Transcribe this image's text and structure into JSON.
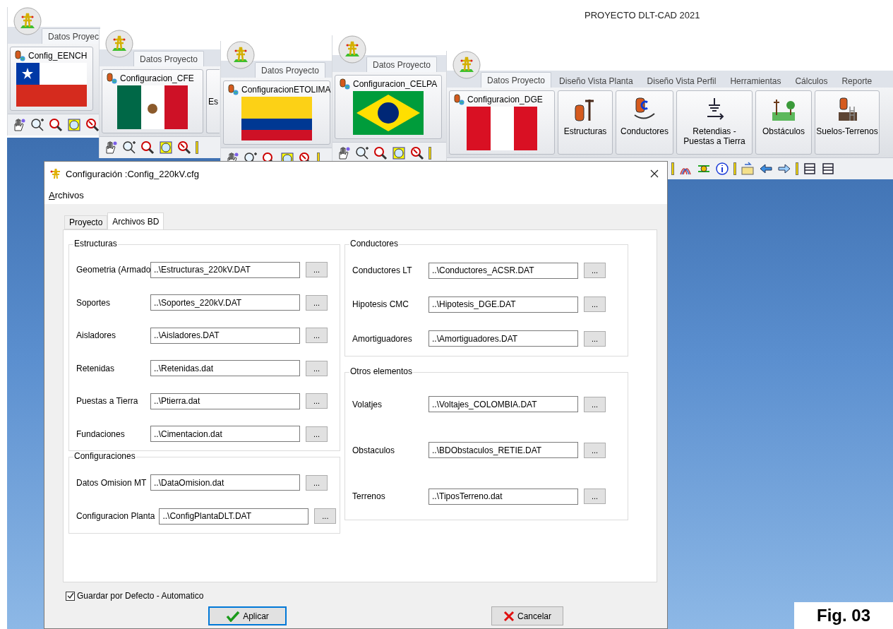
{
  "app_title": "PROYECTO DLT-CAD 2021",
  "ribbon_windows": [
    {
      "tab": "Datos Proyec",
      "config": "Config_EENCH",
      "flag": {
        "kind": "chile"
      }
    },
    {
      "tab": "Datos Proyecto",
      "config": "Configuracion_CFE",
      "flag": {
        "kind": "mexico"
      },
      "next_button": "Es"
    },
    {
      "tab": "Datos Proyecto",
      "config": "ConfiguracionETOLIMA",
      "flag": {
        "kind": "colombia"
      }
    },
    {
      "tab": "Datos Proyecto",
      "config": "Configuracion_CELPA",
      "flag": {
        "kind": "brazil"
      }
    }
  ],
  "main_window": {
    "tabs": [
      {
        "label": "Datos Proyecto",
        "selected": true
      },
      {
        "label": "Diseño Vista Planta",
        "selected": false
      },
      {
        "label": "Diseño Vista Perfil",
        "selected": false
      },
      {
        "label": "Herramientas",
        "selected": false
      },
      {
        "label": "Cálculos",
        "selected": false
      },
      {
        "label": "Reporte",
        "selected": false
      }
    ],
    "config": "Configuracion_DGE",
    "flag": {
      "kind": "peru"
    },
    "ribbon_buttons": [
      {
        "label": "Estructuras",
        "kind": "structures"
      },
      {
        "label": "Conductores",
        "kind": "conductors"
      },
      {
        "label": "Retendias - Puestas a Tierra",
        "kind": "grounding"
      },
      {
        "label": "Obstáculos",
        "kind": "obstacles"
      },
      {
        "label": "Suelos-Terrenos",
        "kind": "soils"
      }
    ]
  },
  "dialog": {
    "title": "Configuración :Config_220kV.cfg",
    "menu": [
      "Archivos"
    ],
    "tabs": [
      {
        "label": "Proyecto",
        "selected": false
      },
      {
        "label": "Archivos BD",
        "selected": true
      }
    ],
    "columns": [
      [
        {
          "title": "Estructuras",
          "rows": [
            {
              "label": "Geometria (Armado",
              "value": "..\\Estructuras_220kV.DAT",
              "browse": "..."
            },
            {
              "label": "Soportes",
              "value": "..\\Soportes_220kV.DAT",
              "browse": "..."
            },
            {
              "label": "Aisladores",
              "value": "..\\Aisladores.DAT",
              "browse": "..."
            },
            {
              "label": "Retenidas",
              "value": "..\\Retenidas.dat",
              "browse": "..."
            },
            {
              "label": "Puestas a Tierra",
              "value": "..\\Ptierra.dat",
              "browse": "..."
            },
            {
              "label": "Fundaciones",
              "value": "..\\Cimentacion.dat",
              "browse": "..."
            }
          ]
        },
        {
          "title": "Configuraciones",
          "rows": [
            {
              "label": "Datos Omision MT",
              "value": "..\\DataOmision.dat",
              "browse": "..."
            },
            {
              "label": "Configuracion Planta",
              "value": "..\\ConfigPlantaDLT.DAT",
              "browse": "..."
            }
          ]
        }
      ],
      [
        {
          "title": "Conductores",
          "rows": [
            {
              "label": "Conductores LT",
              "value": "..\\Conductores_ACSR.DAT",
              "browse": "..."
            },
            {
              "label": "Hipotesis CMC",
              "value": "..\\Hipotesis_DGE.DAT",
              "browse": "..."
            },
            {
              "label": "Amortiguadores",
              "value": "..\\Amortiguadores.DAT",
              "browse": "..."
            }
          ]
        },
        {
          "title": "Otros elementos",
          "rows": [
            {
              "label": "Volatjes",
              "value": "..\\Voltajes_COLOMBIA.DAT",
              "browse": "..."
            },
            {
              "label": "Obstaculos",
              "value": "..\\BDObstaculos_RETIE.DAT",
              "browse": "..."
            },
            {
              "label": "Terrenos",
              "value": "..\\TiposTerreno.dat",
              "browse": "..."
            }
          ]
        }
      ]
    ],
    "checkbox": {
      "label": "Guardar por Defecto - Automatico",
      "checked": true
    },
    "buttons": [
      {
        "label": "Aplicar",
        "kind": "apply",
        "focused": true
      },
      {
        "label": "Cancelar",
        "kind": "cancel",
        "focused": false
      }
    ]
  },
  "figure_label": "Fig. 03"
}
